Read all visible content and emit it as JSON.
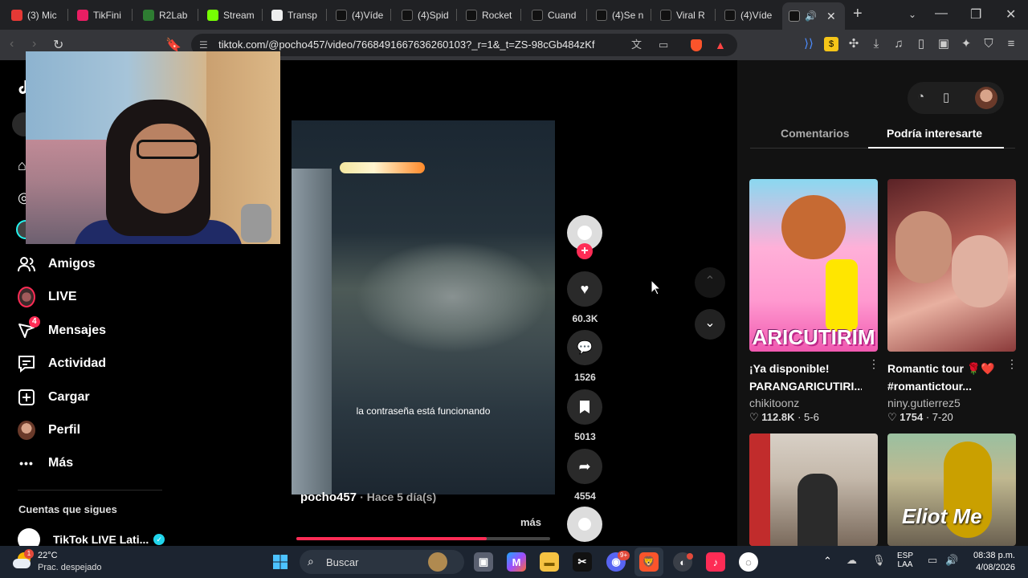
{
  "tabs": [
    {
      "label": "(3) Mic",
      "color": "#e53935"
    },
    {
      "label": "TikFini",
      "color": "#e91e63"
    },
    {
      "label": "R2Lab",
      "color": "#2e7d32"
    },
    {
      "label": "Stream",
      "color": "#76ff03"
    },
    {
      "label": "Transp",
      "color": "#eeeeee"
    },
    {
      "label": "(4)Víde",
      "color": "#111111"
    },
    {
      "label": "(4)Spid",
      "color": "#111111"
    },
    {
      "label": "Rocket",
      "color": "#111111"
    },
    {
      "label": "Cuand",
      "color": "#111111"
    },
    {
      "label": "(4)Se n",
      "color": "#111111"
    },
    {
      "label": "Viral R",
      "color": "#111111"
    },
    {
      "label": "(4)Víde",
      "color": "#111111"
    }
  ],
  "address": {
    "url": "tiktok.com/@pocho457/video/7668491667636260103?_r=1&_t=ZS-98cGb484zKf"
  },
  "sidebar": {
    "items": [
      {
        "label": "Amigos",
        "icon": "friends-icon"
      },
      {
        "label": "LIVE",
        "icon": "live-icon"
      },
      {
        "label": "Mensajes",
        "icon": "messages-icon",
        "badge": "4"
      },
      {
        "label": "Actividad",
        "icon": "activity-icon"
      },
      {
        "label": "Cargar",
        "icon": "upload-icon"
      },
      {
        "label": "Perfil",
        "icon": "profile-icon"
      },
      {
        "label": "Más",
        "icon": "more-icon"
      }
    ],
    "following_heading": "Cuentas que sigues",
    "following": [
      {
        "name": "TikTok LIVE Lati..."
      }
    ]
  },
  "video": {
    "caption": "la contraseña está funcionando",
    "author": "pocho457",
    "posted": "· Hace 5 día(s)",
    "more": "más",
    "progress": 0.75
  },
  "actions": {
    "likes": "60.3K",
    "comments": "1526",
    "saves": "5013",
    "shares": "4554"
  },
  "panel": {
    "tab_comments": "Comentarios",
    "tab_suggested": "Podría interesarte",
    "cards": [
      {
        "title": "¡Ya disponible! PARANGARICUTIRI...",
        "author": "chikitoonz",
        "likes": "112.8K",
        "date": "5-6",
        "thumb_text": "ARICUTIRIM"
      },
      {
        "title": "Romantic tour 🌹❤️ #romantictour...",
        "author": "niny.gutierrez5",
        "likes": "1754",
        "date": "7-20",
        "thumb_text": ""
      },
      {
        "title": "",
        "author": "",
        "likes": "",
        "date": "",
        "thumb_text": ""
      },
      {
        "title": "",
        "author": "",
        "likes": "",
        "date": "",
        "thumb_text": "Eliot Me"
      }
    ]
  },
  "taskbar": {
    "weather_temp": "22°C",
    "weather_desc": "Prac. despejado",
    "search_placeholder": "Buscar",
    "lang": "ESP",
    "lang_sub": "LAA",
    "time": "08:38 p.m.",
    "date": "4/08/2026"
  }
}
